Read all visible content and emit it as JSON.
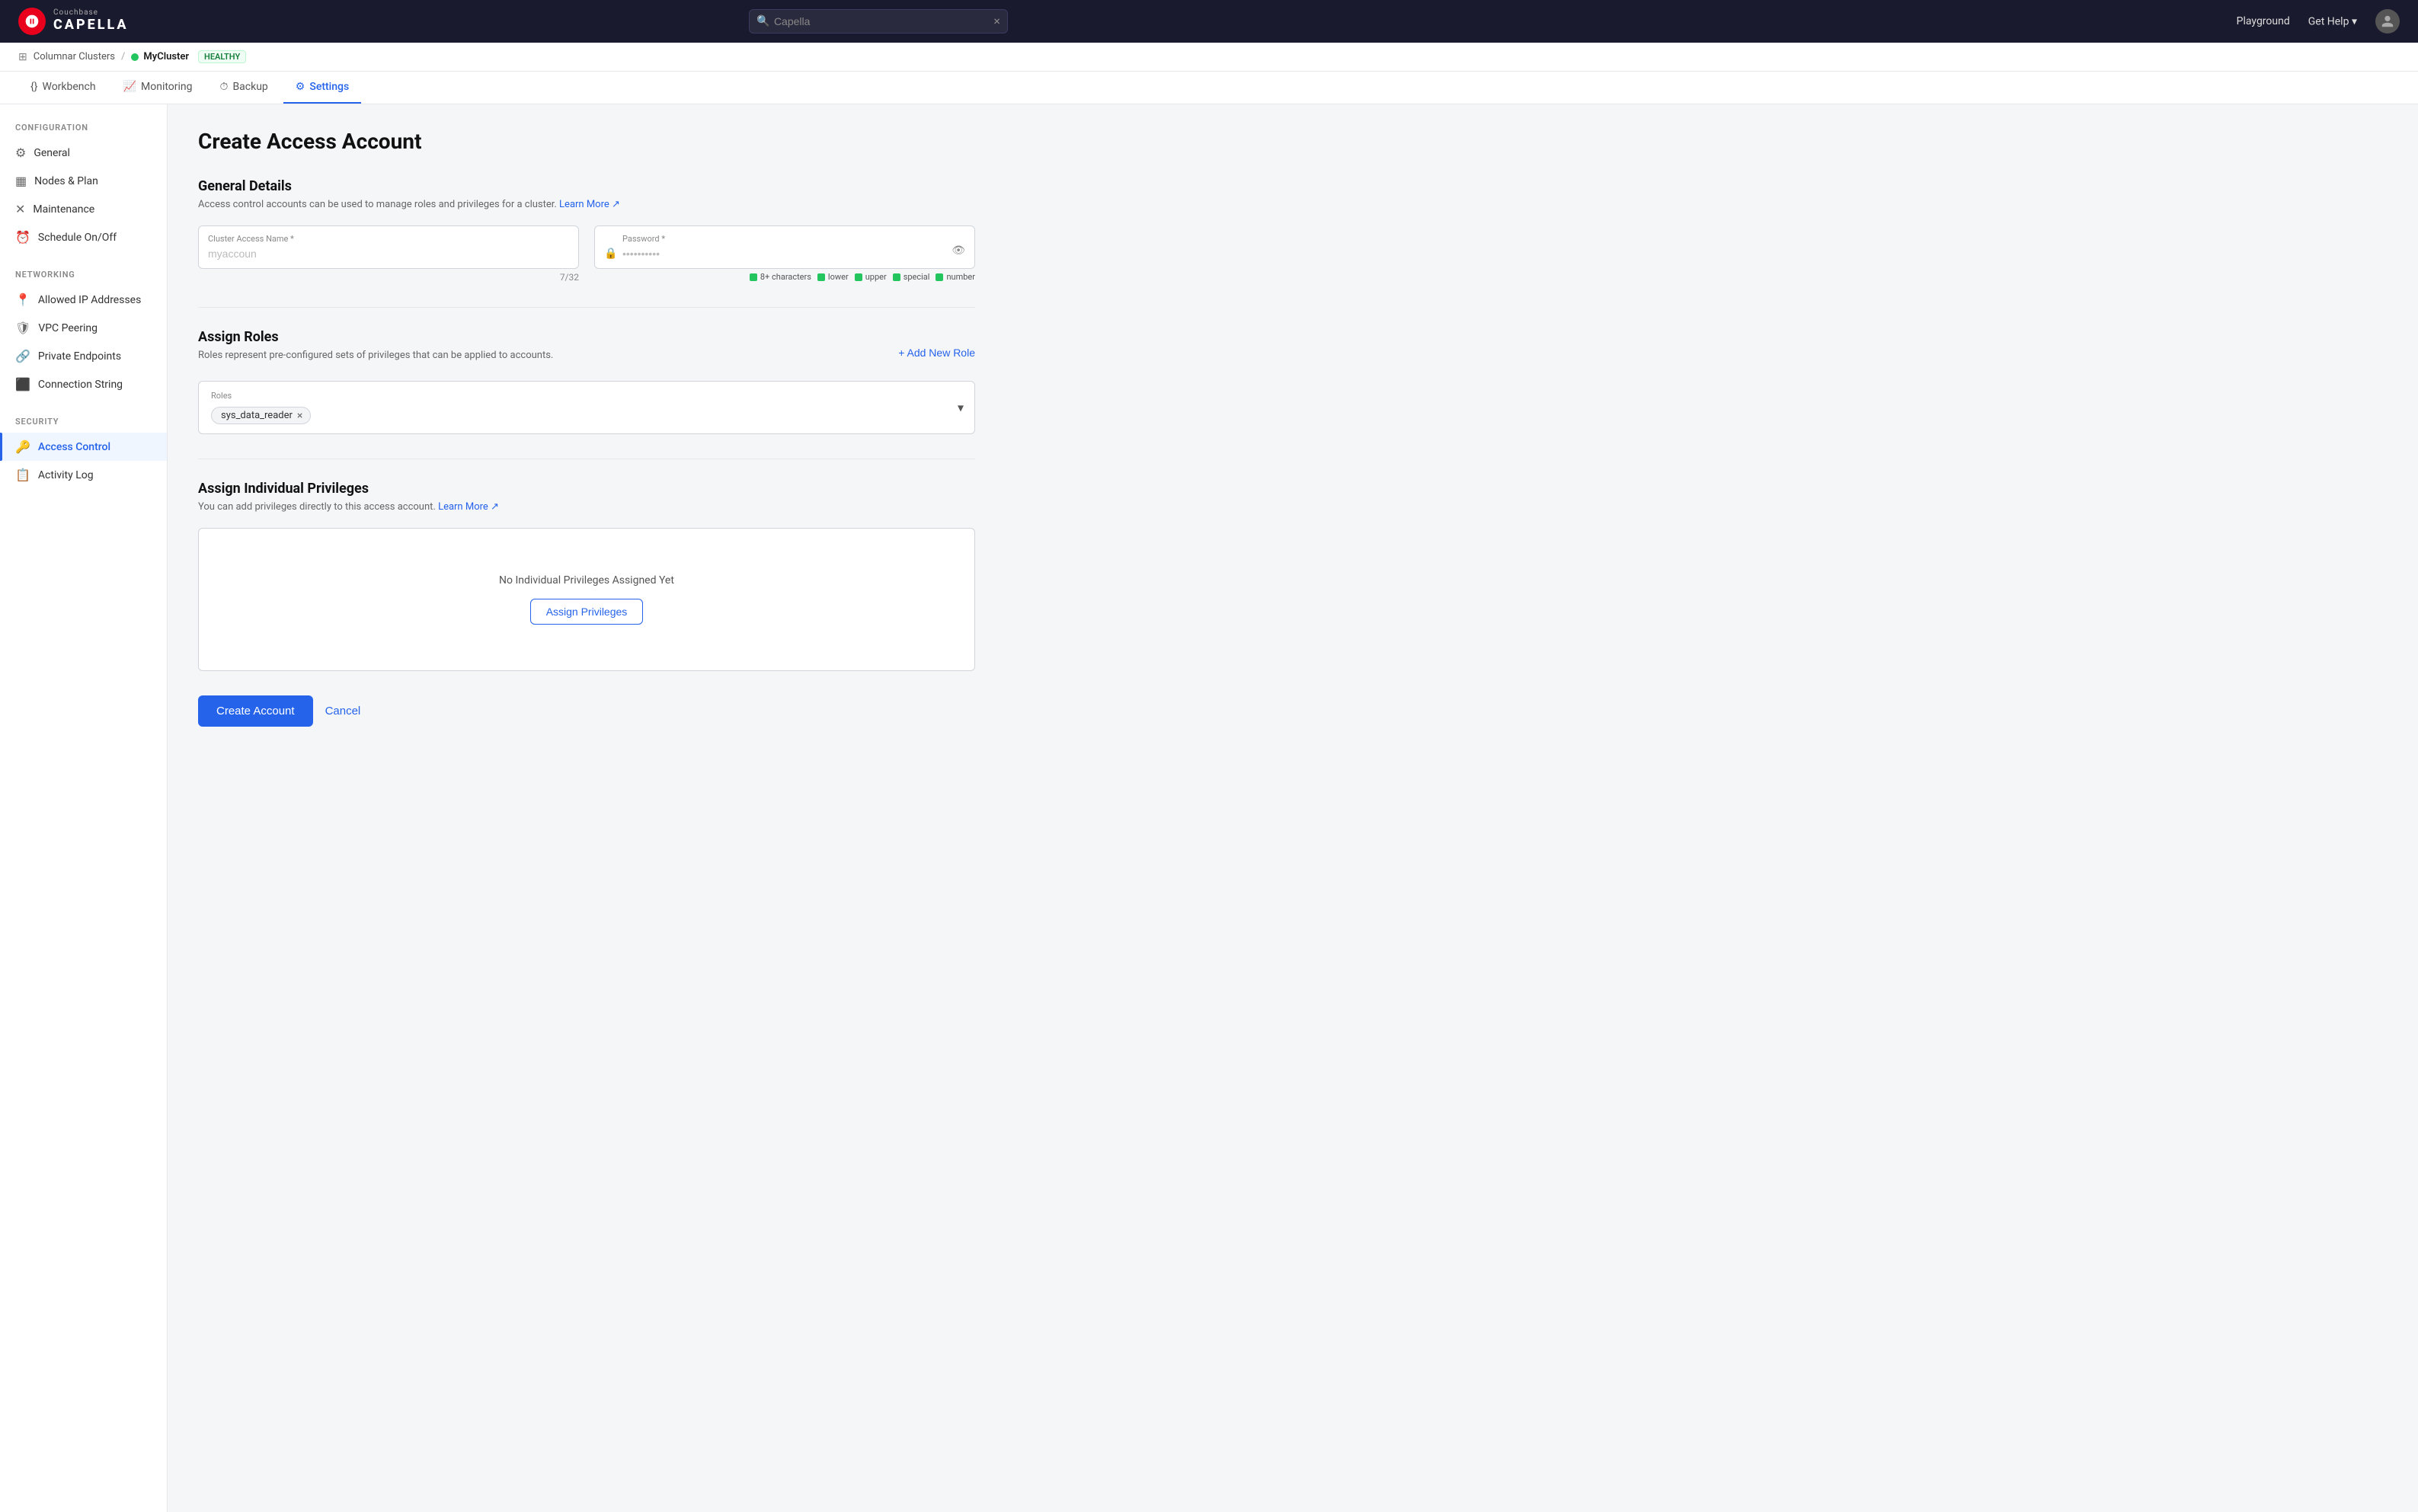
{
  "topbar": {
    "brand_sub": "Couchbase",
    "brand_name": "CAPELLA",
    "search_placeholder": "Capella",
    "search_value": "",
    "playground_label": "Playground",
    "get_help_label": "Get Help"
  },
  "breadcrumb": {
    "parent": "Columnar Clusters",
    "cluster_name": "MyCluster",
    "status": "HEALTHY"
  },
  "tabs": [
    {
      "id": "workbench",
      "label": "Workbench",
      "icon": "{}"
    },
    {
      "id": "monitoring",
      "label": "Monitoring",
      "icon": "📈"
    },
    {
      "id": "backup",
      "label": "Backup",
      "icon": "⏱"
    },
    {
      "id": "settings",
      "label": "Settings",
      "icon": "⚙",
      "active": true
    }
  ],
  "sidebar": {
    "sections": [
      {
        "label": "CONFIGURATION",
        "items": [
          {
            "id": "general",
            "label": "General",
            "icon": "gear"
          },
          {
            "id": "nodes-plan",
            "label": "Nodes & Plan",
            "icon": "grid"
          },
          {
            "id": "maintenance",
            "label": "Maintenance",
            "icon": "wrench"
          },
          {
            "id": "schedule",
            "label": "Schedule On/Off",
            "icon": "clock"
          }
        ]
      },
      {
        "label": "NETWORKING",
        "items": [
          {
            "id": "allowed-ip",
            "label": "Allowed IP Addresses",
            "icon": "pin"
          },
          {
            "id": "vpc-peering",
            "label": "VPC Peering",
            "icon": "shield"
          },
          {
            "id": "private-endpoints",
            "label": "Private Endpoints",
            "icon": "link"
          },
          {
            "id": "connection-string",
            "label": "Connection String",
            "icon": "terminal"
          }
        ]
      },
      {
        "label": "SECURITY",
        "items": [
          {
            "id": "access-control",
            "label": "Access Control",
            "icon": "key",
            "active": true
          },
          {
            "id": "activity-log",
            "label": "Activity Log",
            "icon": "doc"
          }
        ]
      }
    ]
  },
  "page": {
    "title": "Create Access Account",
    "general_details": {
      "section_title": "General Details",
      "section_desc": "Access control accounts can be used to manage roles and privileges for a cluster.",
      "learn_more": "Learn More",
      "cluster_access_label": "Cluster Access Name *",
      "cluster_access_placeholder": "myaccount",
      "char_count": "7/32",
      "password_label": "Password *",
      "password_placeholder": "••••••••••",
      "strength_items": [
        {
          "label": "8+ characters",
          "color": "green"
        },
        {
          "label": "lower",
          "color": "green"
        },
        {
          "label": "upper",
          "color": "green"
        },
        {
          "label": "special",
          "color": "green"
        },
        {
          "label": "number",
          "color": "green"
        }
      ]
    },
    "assign_roles": {
      "section_title": "Assign Roles",
      "section_desc": "Roles represent pre-configured sets of privileges that can be applied to accounts.",
      "add_role_label": "+ Add New Role",
      "roles_box_label": "Roles",
      "roles": [
        {
          "id": "sys_data_reader",
          "label": "sys_data_reader"
        }
      ]
    },
    "assign_privileges": {
      "section_title": "Assign Individual Privileges",
      "section_desc": "You can add privileges directly to this access account.",
      "learn_more": "Learn More",
      "empty_text": "No Individual Privileges Assigned Yet",
      "assign_btn": "Assign Privileges"
    },
    "actions": {
      "create_btn": "Create Account",
      "cancel_btn": "Cancel"
    }
  },
  "icons": {
    "gear": "⚙",
    "grid": "▦",
    "wrench": "🔧",
    "clock": "⏰",
    "pin": "📍",
    "shield": "🛡",
    "link": "🔗",
    "terminal": "⬛",
    "key": "🔑",
    "doc": "📋",
    "search": "🔍",
    "eye": "👁",
    "lock": "🔒",
    "chevron_down": "▾",
    "close": "×",
    "external_link": "↗"
  }
}
